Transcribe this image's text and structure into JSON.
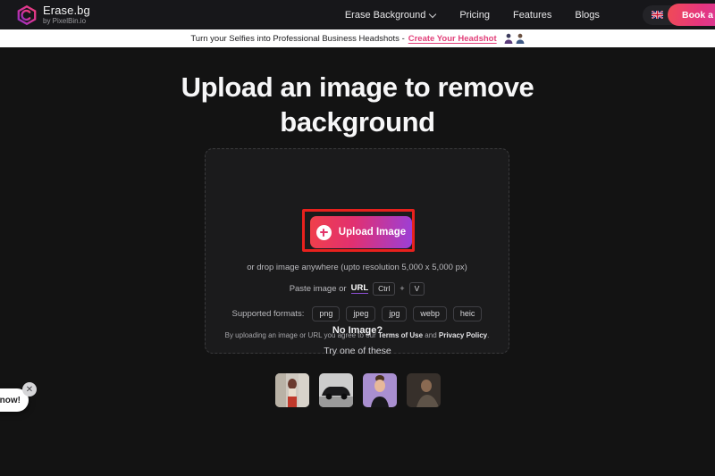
{
  "brand": {
    "name": "Erase.bg",
    "subtitle": "by PixelBin.io",
    "logo_icon": "erasebg-cube-logo-icon"
  },
  "nav": {
    "items": [
      {
        "label": "Erase Background",
        "has_dropdown": true
      },
      {
        "label": "Pricing",
        "has_dropdown": false
      },
      {
        "label": "Features",
        "has_dropdown": false
      },
      {
        "label": "Blogs",
        "has_dropdown": false
      }
    ],
    "language": {
      "label": "English",
      "flag_icon": "uk-flag-icon",
      "chevron_icon": "chevron-down-icon"
    },
    "cta_label": "Book a"
  },
  "banner": {
    "text": "Turn your Selfies into Professional Business Headshots -",
    "link_label": "Create Your Headshot",
    "avatar_icons": [
      "headshot-avatar-icon-1",
      "headshot-avatar-icon-2"
    ]
  },
  "hero": {
    "headline_line1": "Upload an image to remove",
    "headline_line2": "background"
  },
  "upload": {
    "button_label": "Upload Image",
    "plus_icon": "plus-circle-icon",
    "drop_text": "or drop image anywhere (upto resolution 5,000 x 5,000 px)",
    "paste_label": "Paste image or",
    "url_label": "URL",
    "key_ctrl": "Ctrl",
    "key_plus": "+",
    "key_v": "V",
    "formats_label": "Supported formats:",
    "formats": [
      "png",
      "jpeg",
      "jpg",
      "webp",
      "heic"
    ],
    "terms_prefix": "By uploading an image or URL you agree to our ",
    "terms_of_use": "Terms of Use",
    "terms_middle": " and ",
    "privacy_policy": "Privacy Policy",
    "terms_suffix": ".",
    "highlight_color": "#e8211d"
  },
  "samples": {
    "no_image_label": "No Image?",
    "try_label": "Try one of these",
    "items": [
      {
        "name": "sample-woman-outdoors"
      },
      {
        "name": "sample-black-car"
      },
      {
        "name": "sample-woman-purple-bg"
      },
      {
        "name": "sample-dark-portrait"
      }
    ]
  },
  "chat": {
    "bubble_text": "t now!",
    "close_icon": "close-icon"
  },
  "colors": {
    "page_bg": "#131313",
    "nav_bg": "#17171a",
    "banner_bg": "#ffffff",
    "accent_pink": "#e2356a",
    "accent_purple": "#9b3fd8",
    "highlight_red": "#e8211d"
  }
}
